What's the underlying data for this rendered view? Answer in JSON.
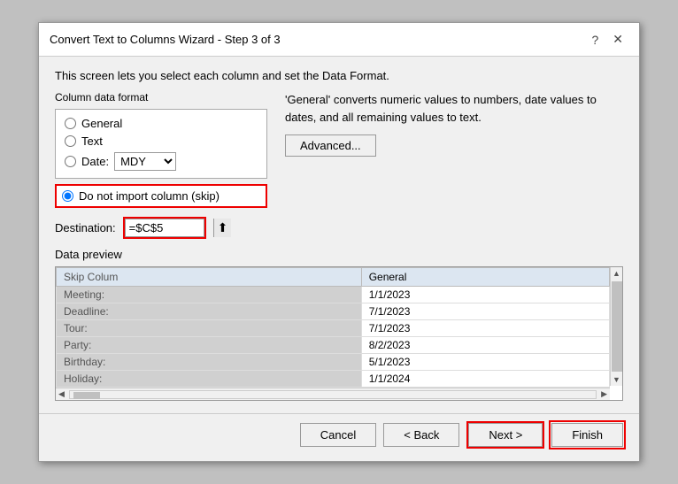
{
  "dialog": {
    "title": "Convert Text to Columns Wizard - Step 3 of 3",
    "help_btn": "?",
    "close_btn": "✕"
  },
  "instruction": "This screen lets you select each column and set the Data Format.",
  "column_format": {
    "group_label": "Column data format",
    "options": [
      {
        "id": "general",
        "label": "General",
        "checked": false
      },
      {
        "id": "text",
        "label": "Text",
        "checked": false
      },
      {
        "id": "date",
        "label": "Date:",
        "checked": false
      },
      {
        "id": "skip",
        "label": "Do not import column (skip)",
        "checked": true
      }
    ],
    "date_value": "MDY"
  },
  "general_desc": "'General' converts numeric values to numbers, date values to dates, and all remaining values to text.",
  "advanced_btn": "Advanced...",
  "destination": {
    "label": "Destination:",
    "value": "=$C$5",
    "icon": "⬆"
  },
  "preview": {
    "label": "Data preview",
    "headers": [
      "Skip Colum",
      "General"
    ],
    "rows": [
      [
        "Meeting:",
        "1/1/2023"
      ],
      [
        "Deadline:",
        "7/1/2023"
      ],
      [
        "Tour:",
        "7/1/2023"
      ],
      [
        "Party:",
        "8/2/2023"
      ],
      [
        "Birthday:",
        "5/1/2023"
      ],
      [
        "Holiday:",
        "1/1/2024"
      ]
    ]
  },
  "footer": {
    "cancel_label": "Cancel",
    "back_label": "< Back",
    "next_label": "Next >",
    "finish_label": "Finish"
  }
}
